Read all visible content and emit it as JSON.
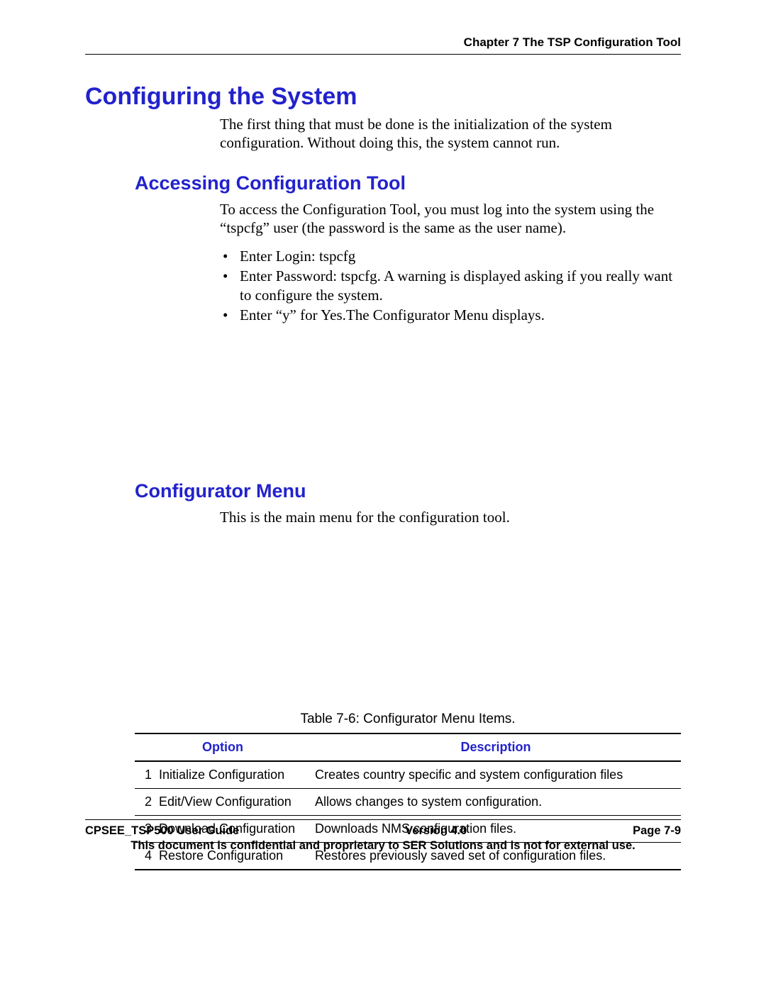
{
  "header": {
    "chapter": "Chapter 7 The TSP Configuration Tool"
  },
  "section1": {
    "title": "Configuring the System",
    "intro": "The first thing that must be done is the initialization of the system configuration.  Without doing this, the system cannot run."
  },
  "section2": {
    "title": "Accessing Configuration Tool",
    "intro": "To access the Configuration Tool, you must log into the system using the “tspcfg” user (the password is the same as the user name).",
    "bullets": [
      "Enter Login:  tspcfg",
      "Enter Password:  tspcfg. A warning is displayed asking if you really want to configure the system.",
      "Enter “y” for Yes.The Configurator Menu displays."
    ]
  },
  "section3": {
    "title": "Configurator Menu",
    "intro": "This is the main menu for the configuration tool."
  },
  "table": {
    "caption": "Table 7-6: Configurator Menu Items.",
    "headers": {
      "option": "Option",
      "description": "Description"
    },
    "rows": [
      {
        "num": "1",
        "option": "Initialize Configuration",
        "description": "Creates country specific and system configuration files"
      },
      {
        "num": "2",
        "option": "Edit/View Configuration",
        "description": "Allows changes to system configuration."
      },
      {
        "num": "3",
        "option": "Download Configuration",
        "description": "Downloads NMS configuration files."
      },
      {
        "num": "4",
        "option": "Restore Configuration",
        "description": "Restores previously saved set of configuration files."
      }
    ]
  },
  "footer": {
    "left": "CPSEE_TSP500 User Guide",
    "center": "Version 4.0",
    "right": "Page 7-9",
    "confidential": "This document is confidential and proprietary to SER Solutions and is not for external use."
  }
}
